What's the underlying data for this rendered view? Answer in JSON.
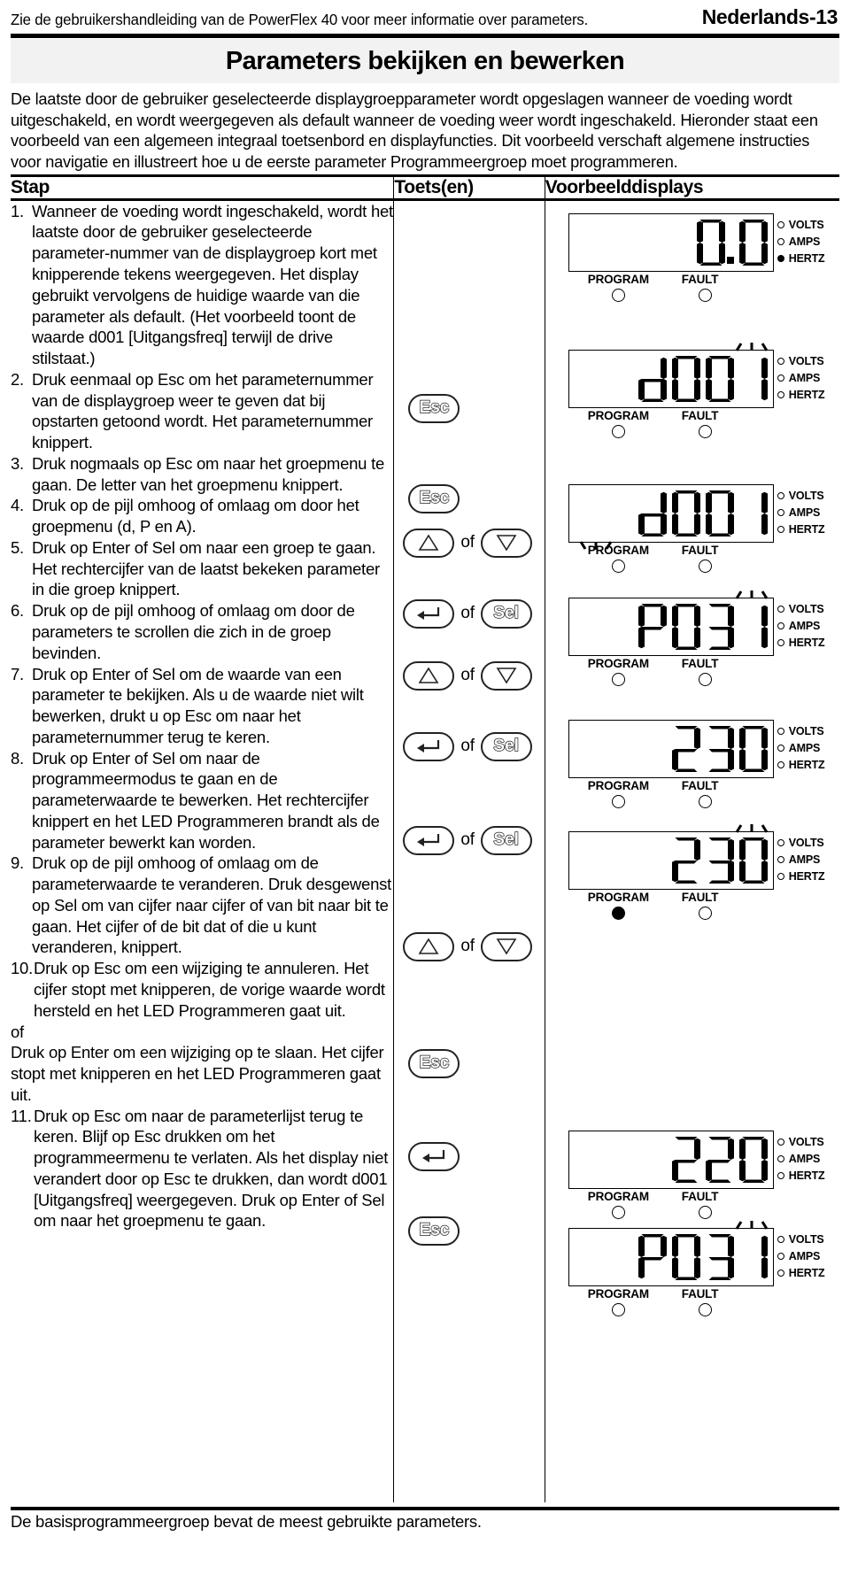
{
  "header": {
    "note": "Zie de gebruikershandleiding van de PowerFlex 40 voor meer informatie over parameters.",
    "page_label": "Nederlands-13"
  },
  "title": "Parameters bekijken en bewerken",
  "intro": "De laatste door de gebruiker geselecteerde displaygroepparameter wordt opgeslagen wanneer de voeding wordt uitgeschakeld, en wordt weergegeven als default wanneer de voeding weer wordt ingeschakeld. Hieronder staat een voorbeeld van een algemeen integraal toetsenbord en displayfuncties. Dit voorbeeld verschaft algemene instructies voor navigatie en illustreert hoe u de eerste parameter Programmeergroep moet programmeren.",
  "table": {
    "columns": {
      "step": "Stap",
      "keys": "Toets(en)",
      "displays": "Voorbeelddisplays"
    },
    "steps": [
      {
        "num": "1.",
        "text": "Wanneer de voeding wordt ingeschakeld, wordt het laatste door de gebruiker geselecteerde parameter-nummer van de displaygroep kort met knipperende tekens weergegeven. Het display gebruikt vervolgens de huidige waarde van die parameter als default. (Het voorbeeld toont de waarde d001 [Uitgangsfreq] terwijl de drive stilstaat.)"
      },
      {
        "num": "2.",
        "text": "Druk eenmaal op Esc om het parameternummer van de displaygroep weer te geven dat bij opstarten getoond wordt. Het parameternummer knippert."
      },
      {
        "num": "3.",
        "text": "Druk nogmaals op Esc om naar het groepmenu te gaan. De letter van het groepmenu knippert."
      },
      {
        "num": "4.",
        "text": "Druk op de pijl omhoog of omlaag om door het groepmenu (d, P en A)."
      },
      {
        "num": "5.",
        "text": "Druk op Enter of Sel om naar een groep te gaan. Het rechtercijfer van de laatst bekeken parameter in die groep knippert."
      },
      {
        "num": "6.",
        "text": "Druk op de pijl omhoog of omlaag om door de parameters te scrollen die zich in de groep bevinden."
      },
      {
        "num": "7.",
        "text": "Druk op Enter of Sel om de waarde van een parameter te bekijken. Als u de waarde niet wilt bewerken, drukt u op Esc om naar het parameternummer terug te keren."
      },
      {
        "num": "8.",
        "text": "Druk op Enter of Sel om naar de programmeermodus te gaan en de parameterwaarde te bewerken. Het rechtercijfer knippert en het LED Programmeren brandt als de parameter bewerkt kan worden."
      },
      {
        "num": "9.",
        "text": "Druk op de pijl omhoog of omlaag om de parameterwaarde te veranderen. Druk desgewenst op Sel om van cijfer naar cijfer of van bit naar bit te gaan. Het cijfer of de bit dat of die u kunt veranderen, knippert."
      },
      {
        "num": "10.",
        "text": "Druk op Esc om een wijziging te annuleren. Het cijfer stopt met knipperen, de vorige waarde wordt hersteld en het LED Programmeren gaat uit.",
        "or_label": "of",
        "text2": "Druk op Enter om een wijziging op te slaan. Het cijfer stopt met knipperen en het LED Programmeren gaat uit."
      },
      {
        "num": "11.",
        "text": "Druk op Esc om naar de parameterlijst terug te keren. Blijf op Esc drukken om het programmeermenu te verlaten. Als het display niet verandert door op Esc te drukken, dan wordt d001 [Uitgangsfreq] weergegeven. Druk op Enter of Sel om naar het groepmenu te gaan."
      }
    ],
    "keys": {
      "esc_label": "Esc",
      "sel_label": "Sel",
      "or_label": "of",
      "icons": {
        "esc": "esc-key-icon",
        "up": "up-arrow-key-icon",
        "down": "down-arrow-key-icon",
        "enter": "enter-key-icon",
        "sel": "sel-key-icon"
      }
    },
    "displays": {
      "unit_labels": {
        "volts": "VOLTS",
        "amps": "AMPS",
        "hertz": "HERTZ"
      },
      "status_labels": {
        "program": "PROGRAM",
        "fault": "FAULT"
      },
      "panels": [
        {
          "value": "0.0",
          "units": {
            "volts": false,
            "amps": false,
            "hertz": true
          },
          "status": {
            "program": false,
            "fault": false
          },
          "blink": "none"
        },
        {
          "value": "d001",
          "units": {
            "volts": false,
            "amps": false,
            "hertz": false
          },
          "status": {
            "program": false,
            "fault": false
          },
          "blink": "last-digit-top"
        },
        {
          "value": "d001",
          "units": {
            "volts": false,
            "amps": false,
            "hertz": false
          },
          "status": {
            "program": false,
            "fault": false
          },
          "blink": "first-digit-bottom"
        },
        {
          "value": "P031",
          "units": {
            "volts": false,
            "amps": false,
            "hertz": false
          },
          "status": {
            "program": false,
            "fault": false
          },
          "blink": "last-digit-top"
        },
        {
          "value": "230",
          "units": {
            "volts": false,
            "amps": false,
            "hertz": false
          },
          "status": {
            "program": false,
            "fault": false
          },
          "blink": "none"
        },
        {
          "value": "230",
          "units": {
            "volts": false,
            "amps": false,
            "hertz": false
          },
          "status": {
            "program": true,
            "fault": false
          },
          "blink": "last-digit-top"
        },
        {
          "value": "220",
          "units": {
            "volts": false,
            "amps": false,
            "hertz": false
          },
          "status": {
            "program": false,
            "fault": false
          },
          "blink": "none"
        },
        {
          "value": "P031",
          "units": {
            "volts": false,
            "amps": false,
            "hertz": false
          },
          "status": {
            "program": false,
            "fault": false
          },
          "blink": "last-digit-top"
        }
      ]
    }
  },
  "footer": "De basisprogrammeergroep bevat de meest gebruikte parameters."
}
